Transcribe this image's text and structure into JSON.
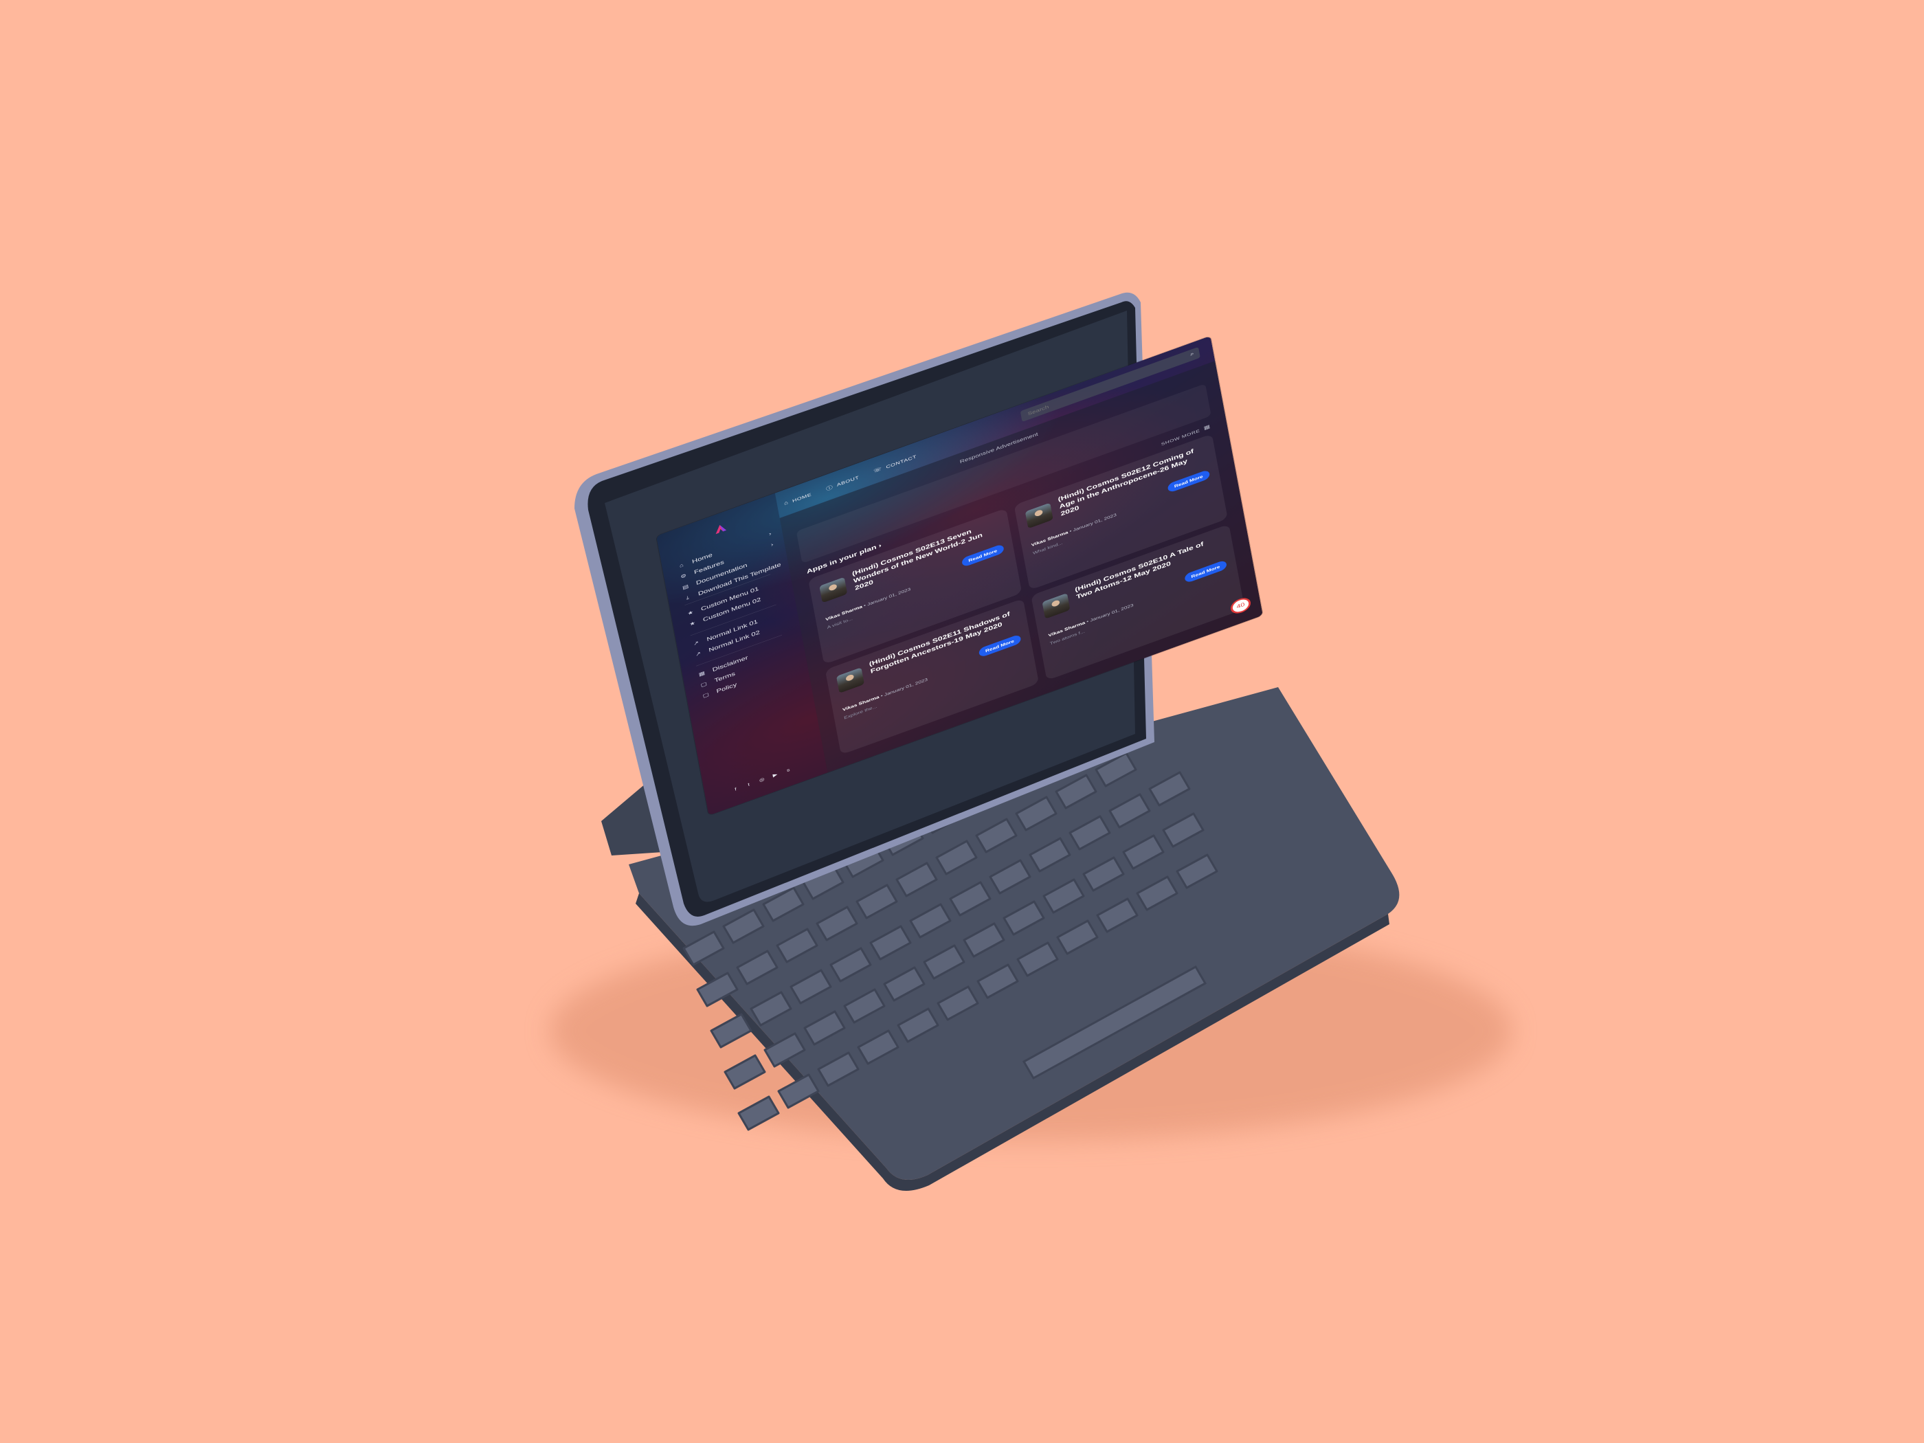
{
  "sidebar": {
    "items": [
      {
        "label": "Home",
        "icon": "home-icon",
        "chevron": true
      },
      {
        "label": "Features",
        "icon": "gear-icon",
        "chevron": true
      },
      {
        "label": "Documentation",
        "icon": "document-icon",
        "chevron": false
      },
      {
        "label": "Download This Template",
        "icon": "download-icon",
        "chevron": false
      },
      {
        "label": "Custom Menu 01",
        "icon": "star-icon",
        "chevron": false
      },
      {
        "label": "Custom Menu 02",
        "icon": "star-icon",
        "chevron": false
      },
      {
        "label": "Normal Link 01",
        "icon": "external-link-icon",
        "chevron": false
      },
      {
        "label": "Normal Link 02",
        "icon": "external-link-icon",
        "chevron": false
      },
      {
        "label": "Disclaimer",
        "icon": "shield-icon",
        "chevron": false
      },
      {
        "label": "Terms",
        "icon": "file-icon",
        "chevron": false
      },
      {
        "label": "Policy",
        "icon": "file-icon",
        "chevron": false
      }
    ],
    "socials": [
      "f",
      "t",
      "◎",
      "▶",
      "s"
    ]
  },
  "topnav": {
    "items": [
      {
        "label": "HOME",
        "icon": "home-icon"
      },
      {
        "label": "ABOUT",
        "icon": "info-icon"
      },
      {
        "label": "CONTACT",
        "icon": "phone-icon"
      }
    ]
  },
  "search": {
    "placeholder": "Search"
  },
  "ad": {
    "label": "Responsive Advertisement"
  },
  "section": {
    "title": "Apps in your plan ›",
    "show_more": "SHOW MORE"
  },
  "cards": [
    {
      "title": "(Hindi) Cosmos S02E13 Seven Wonders of the New World-2 Jun 2020",
      "author": "Vikas Sharma",
      "date": "January 01, 2023",
      "excerpt": "A visit to...",
      "button": "Read More"
    },
    {
      "title": "(Hindi) Cosmos S02E12 Coming of Age in the Anthropocene-26 May 2020",
      "author": "Vikas Sharma",
      "date": "January 01, 2023",
      "excerpt": "What kind...",
      "button": "Read More"
    },
    {
      "title": "(Hindi) Cosmos S02E11 Shadows of Forgotten Ancestors-19 May 2020",
      "author": "Vikas Sharma",
      "date": "January 01, 2023",
      "excerpt": "Explore the...",
      "button": "Read More"
    },
    {
      "title": "(Hindi) Cosmos S02E10 A Tale of Two Atoms-12 May 2020",
      "author": "Vikas Sharma",
      "date": "January 01, 2023",
      "excerpt": "Two atoms f...",
      "button": "Read More"
    }
  ],
  "fab": {
    "label": "40"
  },
  "colors": {
    "background": "#ffb89c",
    "device": "#454c5e",
    "accent": "#1f5ef0",
    "fab_ring": "#e33a3a"
  }
}
